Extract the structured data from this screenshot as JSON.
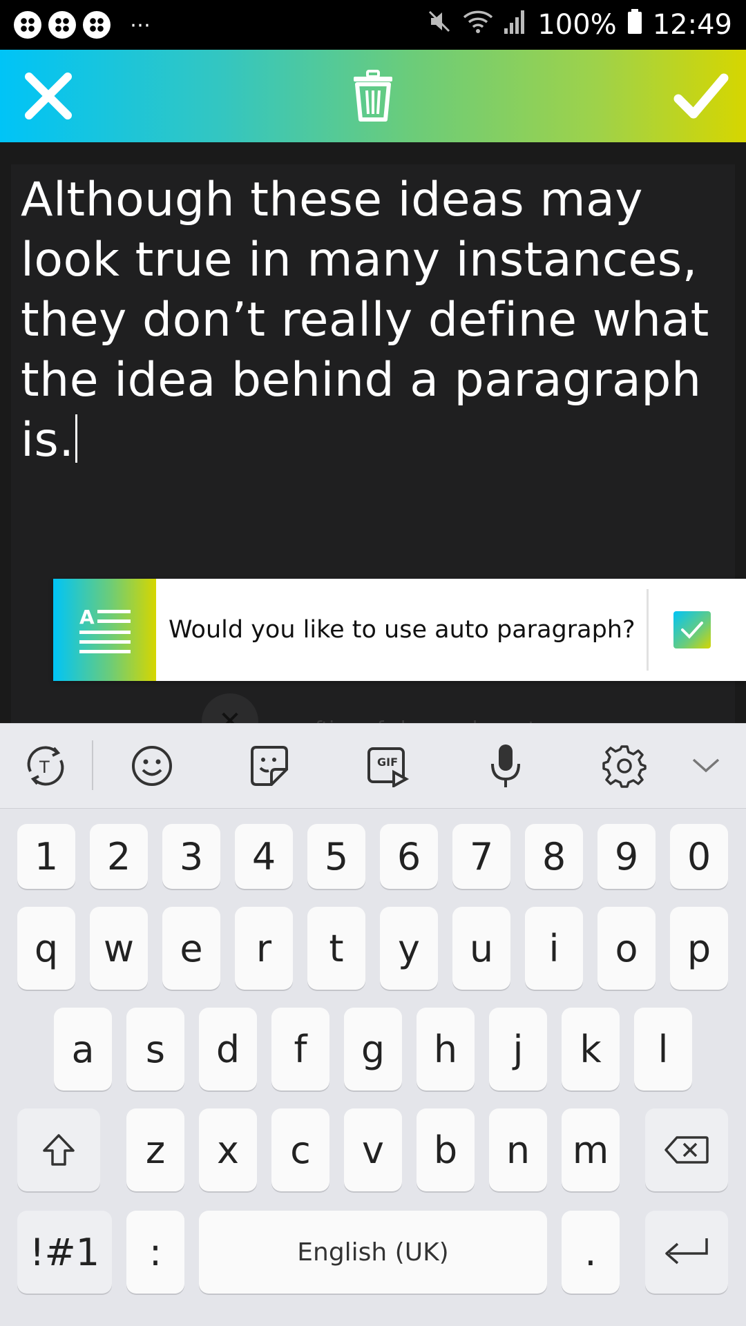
{
  "status_bar": {
    "dots": "⋯",
    "battery": "100%",
    "time": "12:49",
    "icons": [
      "app-icon-1",
      "app-icon-2",
      "app-icon-3",
      "mute-icon",
      "wifi-icon",
      "signal-icon",
      "battery-icon"
    ]
  },
  "toolbar": {
    "icons": [
      "close-icon",
      "trash-icon",
      "check-icon"
    ],
    "colors": {
      "gradient_start": "#00c4f7",
      "gradient_end": "#d6d600"
    }
  },
  "editor": {
    "lines": [
      "Although these ideas may",
      "look true in many instances,",
      "they don’t really define what",
      "the idea behind a paragraph is."
    ],
    "background_ghost_text": "ne crafting of clear, coherent",
    "ghost_close": "✕"
  },
  "banner": {
    "message": "Would you like to use auto paragraph?",
    "icon": "auto-paragraph-icon",
    "checkbox_checked": true
  },
  "keyboard_toolbar": {
    "icons": [
      "text-mode-icon",
      "emoji-icon",
      "sticker-icon",
      "gif-icon",
      "microphone-icon",
      "settings-icon",
      "collapse-chevron-icon"
    ],
    "gif_label": "GIF"
  },
  "keyboard": {
    "row_numbers": [
      "1",
      "2",
      "3",
      "4",
      "5",
      "6",
      "7",
      "8",
      "9",
      "0"
    ],
    "row_1": [
      "q",
      "w",
      "e",
      "r",
      "t",
      "y",
      "u",
      "i",
      "o",
      "p"
    ],
    "row_2": [
      "a",
      "s",
      "d",
      "f",
      "g",
      "h",
      "j",
      "k",
      "l"
    ],
    "row_3": [
      "z",
      "x",
      "c",
      "v",
      "b",
      "n",
      "m"
    ],
    "symbols_key": "!#1",
    "colon_key": ":",
    "space_label": "English (UK)",
    "period_key": "."
  }
}
